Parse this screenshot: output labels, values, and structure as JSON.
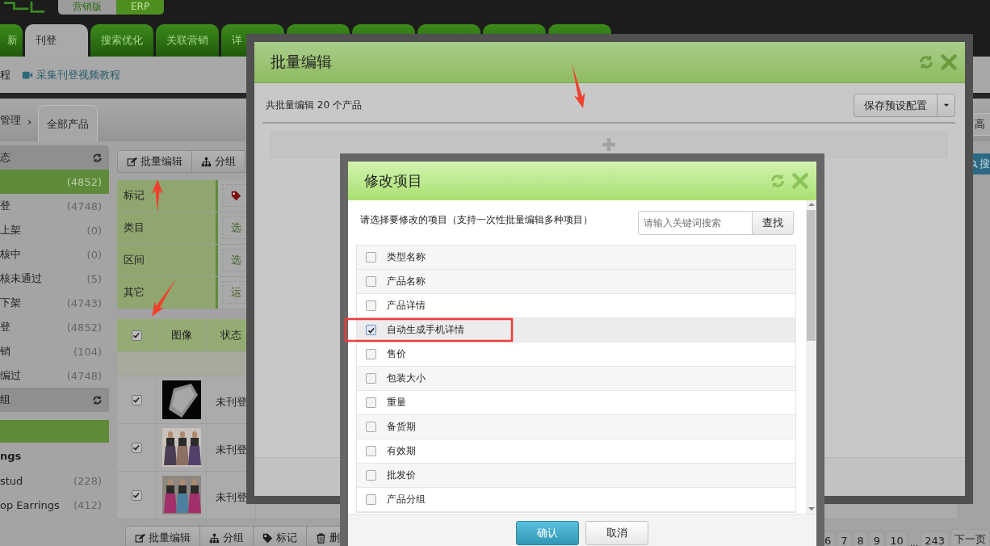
{
  "top_bar": {
    "editions": [
      {
        "label": "营销版",
        "selected": true
      },
      {
        "label": "ERP",
        "selected": false
      }
    ]
  },
  "nav_tabs": [
    {
      "label": "新",
      "selected": false
    },
    {
      "label": "刊登",
      "selected": true
    },
    {
      "label": "搜索优化",
      "selected": false
    },
    {
      "label": "关联营销",
      "selected": false
    },
    {
      "label": "详",
      "selected": false
    },
    {
      "selected": false
    },
    {
      "selected": false
    },
    {
      "selected": false
    },
    {
      "selected": false
    },
    {
      "selected": false
    }
  ],
  "sub_nav": {
    "links": [
      "程",
      "采集刊登视频教程"
    ]
  },
  "breadcrumb": {
    "parent": "管理",
    "separator": "›",
    "current": "全部产品",
    "advanced_button": "高"
  },
  "sidebar": {
    "status_title": "态",
    "status_items": [
      {
        "count": "(4852)",
        "selected": true
      },
      {
        "label": "登",
        "count": "(4748)",
        "selected": false
      },
      {
        "label": "上架",
        "count": "(0)",
        "selected": false
      },
      {
        "label": "核中",
        "count": "(0)",
        "selected": false
      },
      {
        "label": "核未通过",
        "count": "(5)",
        "selected": false
      },
      {
        "label": "下架",
        "count": "(4743)",
        "selected": false
      },
      {
        "label": "登",
        "count": "(4852)",
        "selected": false
      },
      {
        "label": "销",
        "count": "(104)",
        "selected": false
      },
      {
        "label": "编过",
        "count": "(4748)",
        "selected": false
      }
    ],
    "group_title": "组",
    "group_items": [
      {
        "kind": "item",
        "selected": true
      },
      {
        "kind": "heading",
        "label": "ngs"
      },
      {
        "kind": "item",
        "label": "stud",
        "count": "(228)",
        "selected": false
      },
      {
        "kind": "item",
        "label": "op Earrings",
        "count": "(412)",
        "selected": false
      }
    ]
  },
  "toolbar": [
    {
      "label": "批量编辑",
      "kind": "edit"
    },
    {
      "label": "分组",
      "kind": "group"
    }
  ],
  "search_button": "搜",
  "filters": [
    {
      "label": "标记",
      "kind": "tag"
    },
    {
      "label": "类目",
      "value": "选",
      "kind": "select"
    },
    {
      "label": "区间",
      "value": "选",
      "kind": "select"
    },
    {
      "label": "其它",
      "value": "运",
      "kind": "select"
    }
  ],
  "table": {
    "select_all": {
      "checked": true
    },
    "columns": [
      "图像",
      "状态"
    ],
    "rows": [
      {
        "checked": true,
        "status": "未刊登"
      },
      {
        "checked": true,
        "status": "未刊登"
      },
      {
        "checked": true,
        "status": "未刊登"
      }
    ]
  },
  "bottom_toolbar": [
    {
      "label": "批量编辑",
      "kind": "edit"
    },
    {
      "label": "分组",
      "kind": "group"
    },
    {
      "label": "标记",
      "kind": "tag"
    },
    {
      "label": "删",
      "kind": "delete"
    }
  ],
  "pagination": [
    {
      "label": "6",
      "kind": "page"
    },
    {
      "label": "7",
      "kind": "page"
    },
    {
      "label": "8",
      "kind": "page"
    },
    {
      "label": "9",
      "kind": "page"
    },
    {
      "label": "10",
      "kind": "page"
    },
    {
      "label": "...",
      "kind": "gap"
    },
    {
      "label": "243",
      "kind": "page"
    },
    {
      "label": "下一页",
      "kind": "page"
    }
  ],
  "batch_dialog": {
    "title": "批量编辑",
    "summary": "共批量编辑 20 个产品",
    "preset_button": "保存预设配置"
  },
  "items_dialog": {
    "title": "修改项目",
    "instruction": "请选择要修改的项目（支持一次性批量编辑多种项目）",
    "search": {
      "placeholder": "请输入关键词搜索"
    },
    "search_button": "查找",
    "items": [
      {
        "label": "类型名称",
        "checked": false
      },
      {
        "label": "产品名称",
        "checked": false
      },
      {
        "label": "产品详情",
        "checked": false
      },
      {
        "label": "自动生成手机详情",
        "checked": true
      },
      {
        "label": "售价",
        "checked": false
      },
      {
        "label": "包装大小",
        "checked": false
      },
      {
        "label": "重量",
        "checked": false
      },
      {
        "label": "备货期",
        "checked": false
      },
      {
        "label": "有效期",
        "checked": false
      },
      {
        "label": "批发价",
        "checked": false
      },
      {
        "label": "产品分组",
        "checked": false
      }
    ],
    "buttons": [
      {
        "label": "确认",
        "kind": "primary"
      },
      {
        "label": "取消",
        "kind": "default"
      }
    ]
  }
}
